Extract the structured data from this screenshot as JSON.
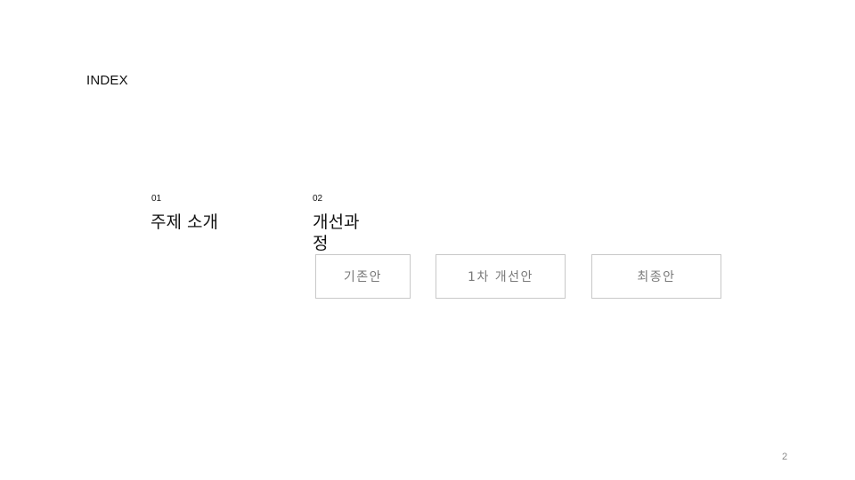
{
  "slide": {
    "title": "INDEX",
    "page_number": "2"
  },
  "sections": [
    {
      "number": "01",
      "title": "주제 소개"
    },
    {
      "number": "02",
      "title": "개선과정"
    }
  ],
  "options": [
    {
      "label": "기존안"
    },
    {
      "label": "1차 개선안"
    },
    {
      "label": "최종안"
    }
  ]
}
